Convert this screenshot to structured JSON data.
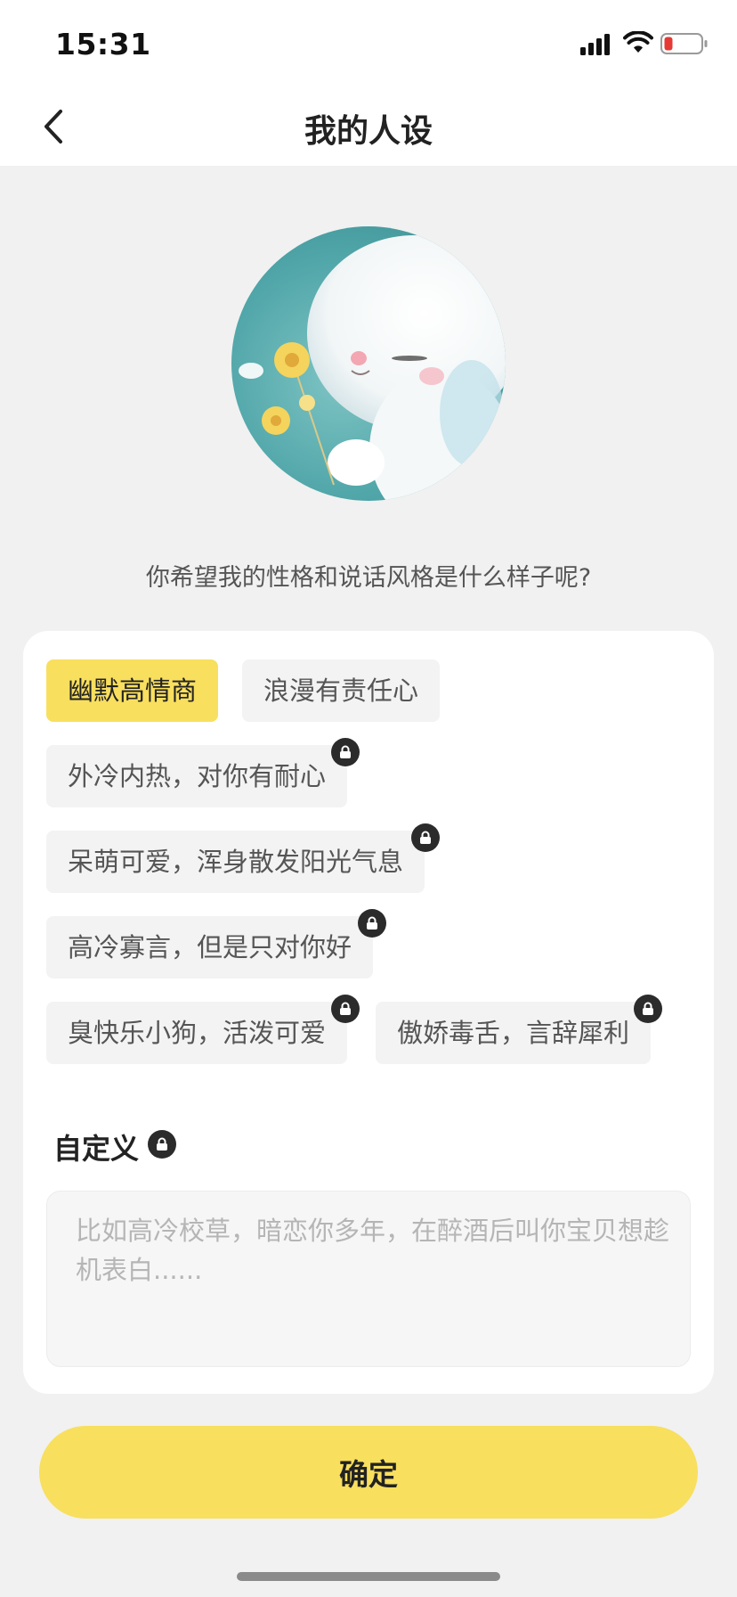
{
  "status_bar": {
    "time": "15:31",
    "signal_icon": "signal-icon",
    "wifi_icon": "wifi-icon",
    "battery_icon": "battery-low-icon",
    "battery_color": "#e53935"
  },
  "nav": {
    "back_icon": "chevron-left-icon",
    "title": "我的人设"
  },
  "avatar": {
    "icon": "avatar-image"
  },
  "prompt": "你希望我的性格和说话风格是什么样子呢?",
  "options": [
    {
      "label": "幽默高情商",
      "selected": true,
      "locked": false
    },
    {
      "label": "浪漫有责任心",
      "selected": false,
      "locked": false
    },
    {
      "label": "外冷内热，对你有耐心",
      "selected": false,
      "locked": true
    },
    {
      "label": "呆萌可爱，浑身散发阳光气息",
      "selected": false,
      "locked": true
    },
    {
      "label": "高冷寡言，但是只对你好",
      "selected": false,
      "locked": true
    },
    {
      "label": "臭快乐小狗，活泼可爱",
      "selected": false,
      "locked": true
    },
    {
      "label": "傲娇毒舌，言辞犀利",
      "selected": false,
      "locked": true
    }
  ],
  "custom": {
    "label": "自定义",
    "locked": true,
    "placeholder": "比如高冷校草，暗恋你多年，在醉酒后叫你宝贝想趁机表白......",
    "value": ""
  },
  "confirm_label": "确定",
  "colors": {
    "accent": "#f8df5e",
    "background": "#f1f1f1",
    "card": "#ffffff",
    "chip": "#f3f3f3",
    "lock_badge": "#2b2b2b"
  }
}
